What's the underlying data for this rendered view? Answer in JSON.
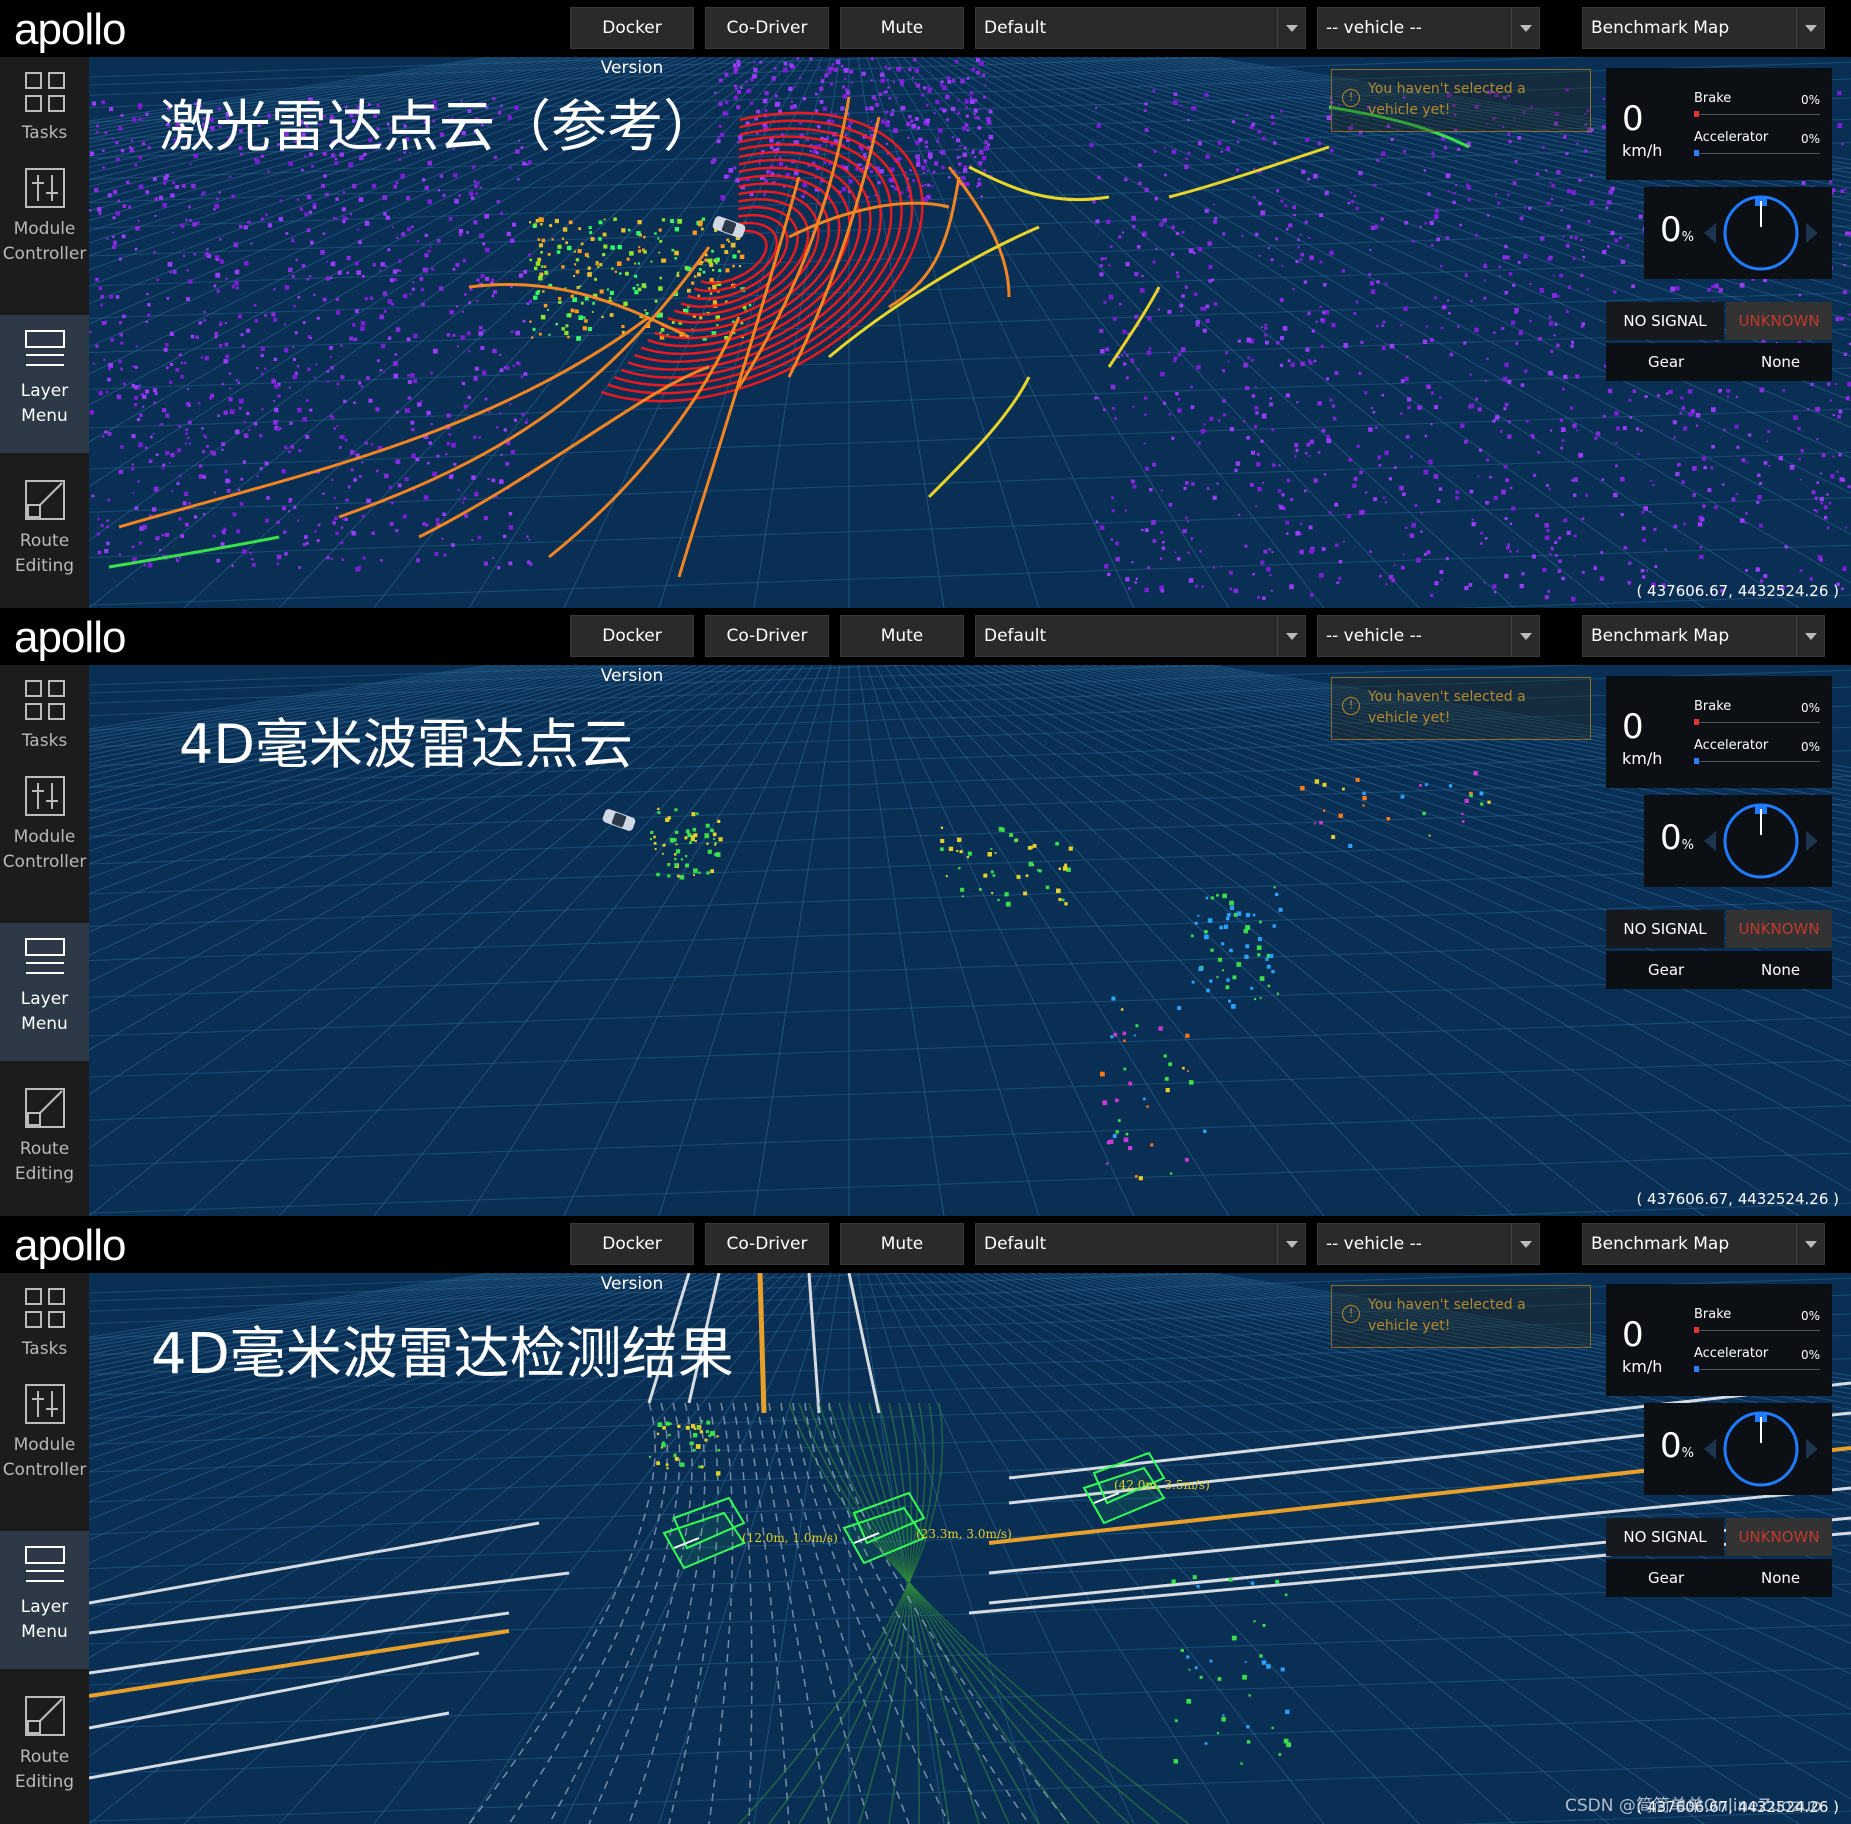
{
  "header": {
    "logo": "apollo",
    "docker_version": "Docker Version",
    "co_driver": "Co-Driver",
    "mute": "Mute",
    "mode_select": "Default",
    "vehicle_select": "-- vehicle --",
    "map_select": "Benchmark Map"
  },
  "sidebar": {
    "tasks": "Tasks",
    "module_controller": [
      "Module",
      "Controller"
    ],
    "layer_menu": [
      "Layer",
      "Menu"
    ],
    "route_editing": [
      "Route",
      "Editing"
    ]
  },
  "panels": [
    {
      "title": "激光雷达点云（参考）"
    },
    {
      "title": "4D毫米波雷达点云"
    },
    {
      "title": "4D毫米波雷达检测结果"
    }
  ],
  "warning": "You haven't selected a vehicle yet!",
  "dashboard": {
    "speed": "0",
    "speed_unit": "km/h",
    "brake_label": "Brake",
    "brake_value": "0%",
    "accelerator_label": "Accelerator",
    "accelerator_value": "0%",
    "steering": "0",
    "steering_unit": "%",
    "signal": "NO SIGNAL",
    "signal_state": "UNKNOWN",
    "gear_label": "Gear",
    "gear_value": "None"
  },
  "coordinates": "( 437606.67, 4432524.26 )",
  "detections": [
    {
      "label": "(12.0m, 1.0m/s)"
    },
    {
      "label": "(23.3m, 3.0m/s)"
    },
    {
      "label": "(42.0m, 3.5m/s)"
    }
  ],
  "watermark": "CSDN @简简单单OnlineZuozuo",
  "colors": {
    "background": "#0a2f55",
    "grid": "#2f6f9a",
    "lidar_red": "#ff1a1a",
    "lidar_orange": "#ff8a1f",
    "radar_detection": "#33ff55",
    "lane_yellow": "#e8a02a",
    "warning": "#b5882c",
    "unknown_red": "#c0392b"
  }
}
